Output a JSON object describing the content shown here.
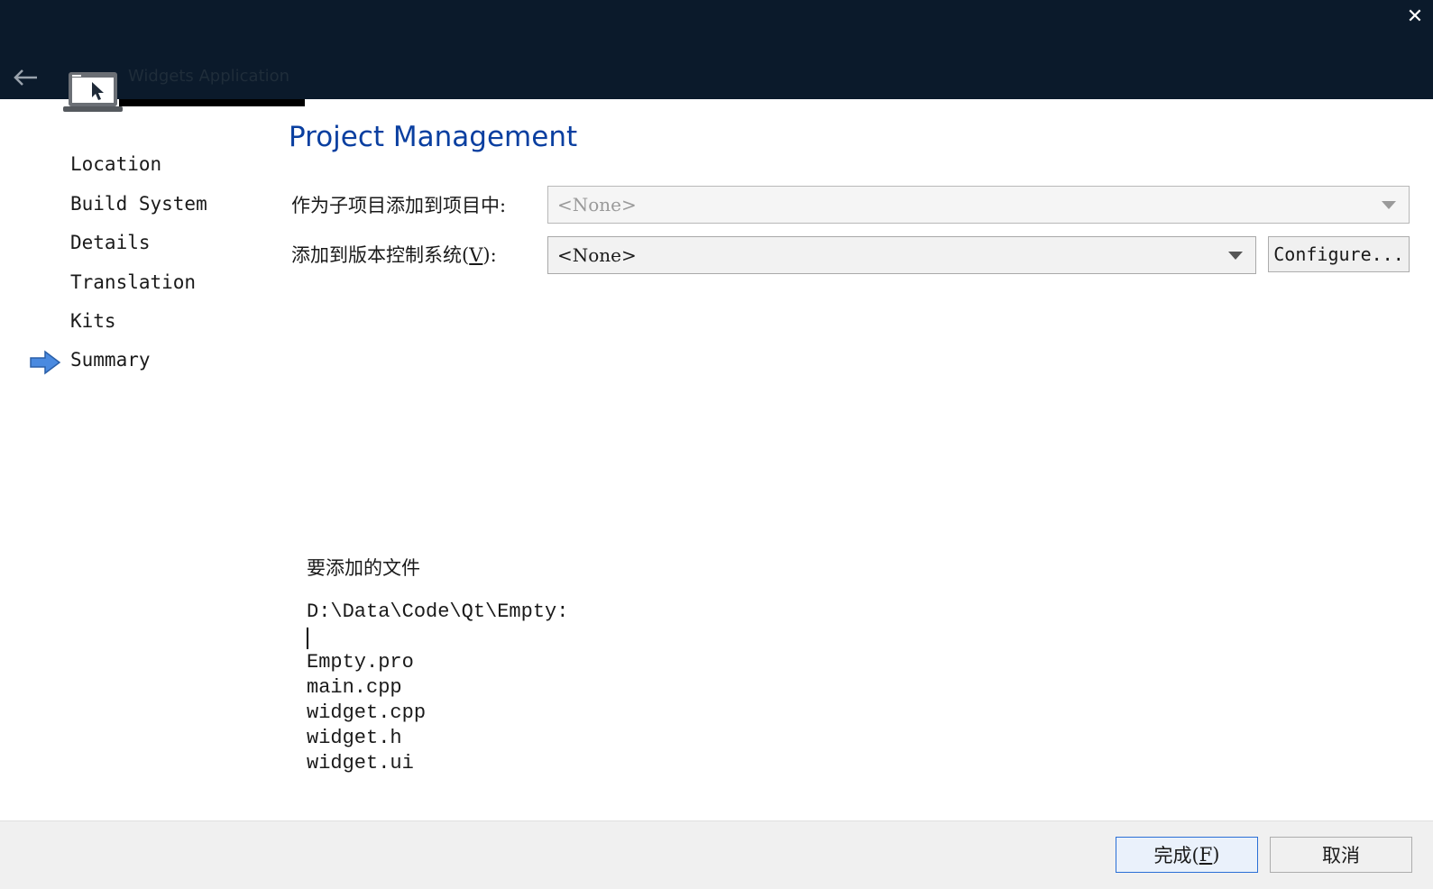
{
  "header": {
    "app_title": "Widgets Application",
    "close_glyph": "✕"
  },
  "steps": [
    {
      "label": "Location"
    },
    {
      "label": "Build System"
    },
    {
      "label": "Details"
    },
    {
      "label": "Translation"
    },
    {
      "label": "Kits"
    },
    {
      "label": "Summary",
      "current": true
    }
  ],
  "page": {
    "title": "Project Management",
    "subproject_label": "作为子项目添加到项目中:",
    "subproject_value": "<None>",
    "vcs_label_pre": "添加到版本控制系统(",
    "vcs_label_mnemonic": "V",
    "vcs_label_post": "):",
    "vcs_value": "<None>",
    "configure_label": "Configure..."
  },
  "summary": {
    "heading": "要添加的文件",
    "path": "D:\\Data\\Code\\Qt\\Empty:",
    "files": [
      "Empty.pro",
      "main.cpp",
      "widget.cpp",
      "widget.h",
      "widget.ui"
    ]
  },
  "footer": {
    "finish_pre": "完成(",
    "finish_mnemonic": "F",
    "finish_post": ")",
    "cancel_label": "取消"
  },
  "colors": {
    "titlebar": "#0b1a2b",
    "accent_title": "#0a3fa0",
    "step_arrow": "#3a7bd5"
  },
  "icons": {
    "back": "arrow-left-icon",
    "app": "laptop-cursor-icon",
    "close": "close-icon",
    "current_step": "arrow-right-icon"
  }
}
